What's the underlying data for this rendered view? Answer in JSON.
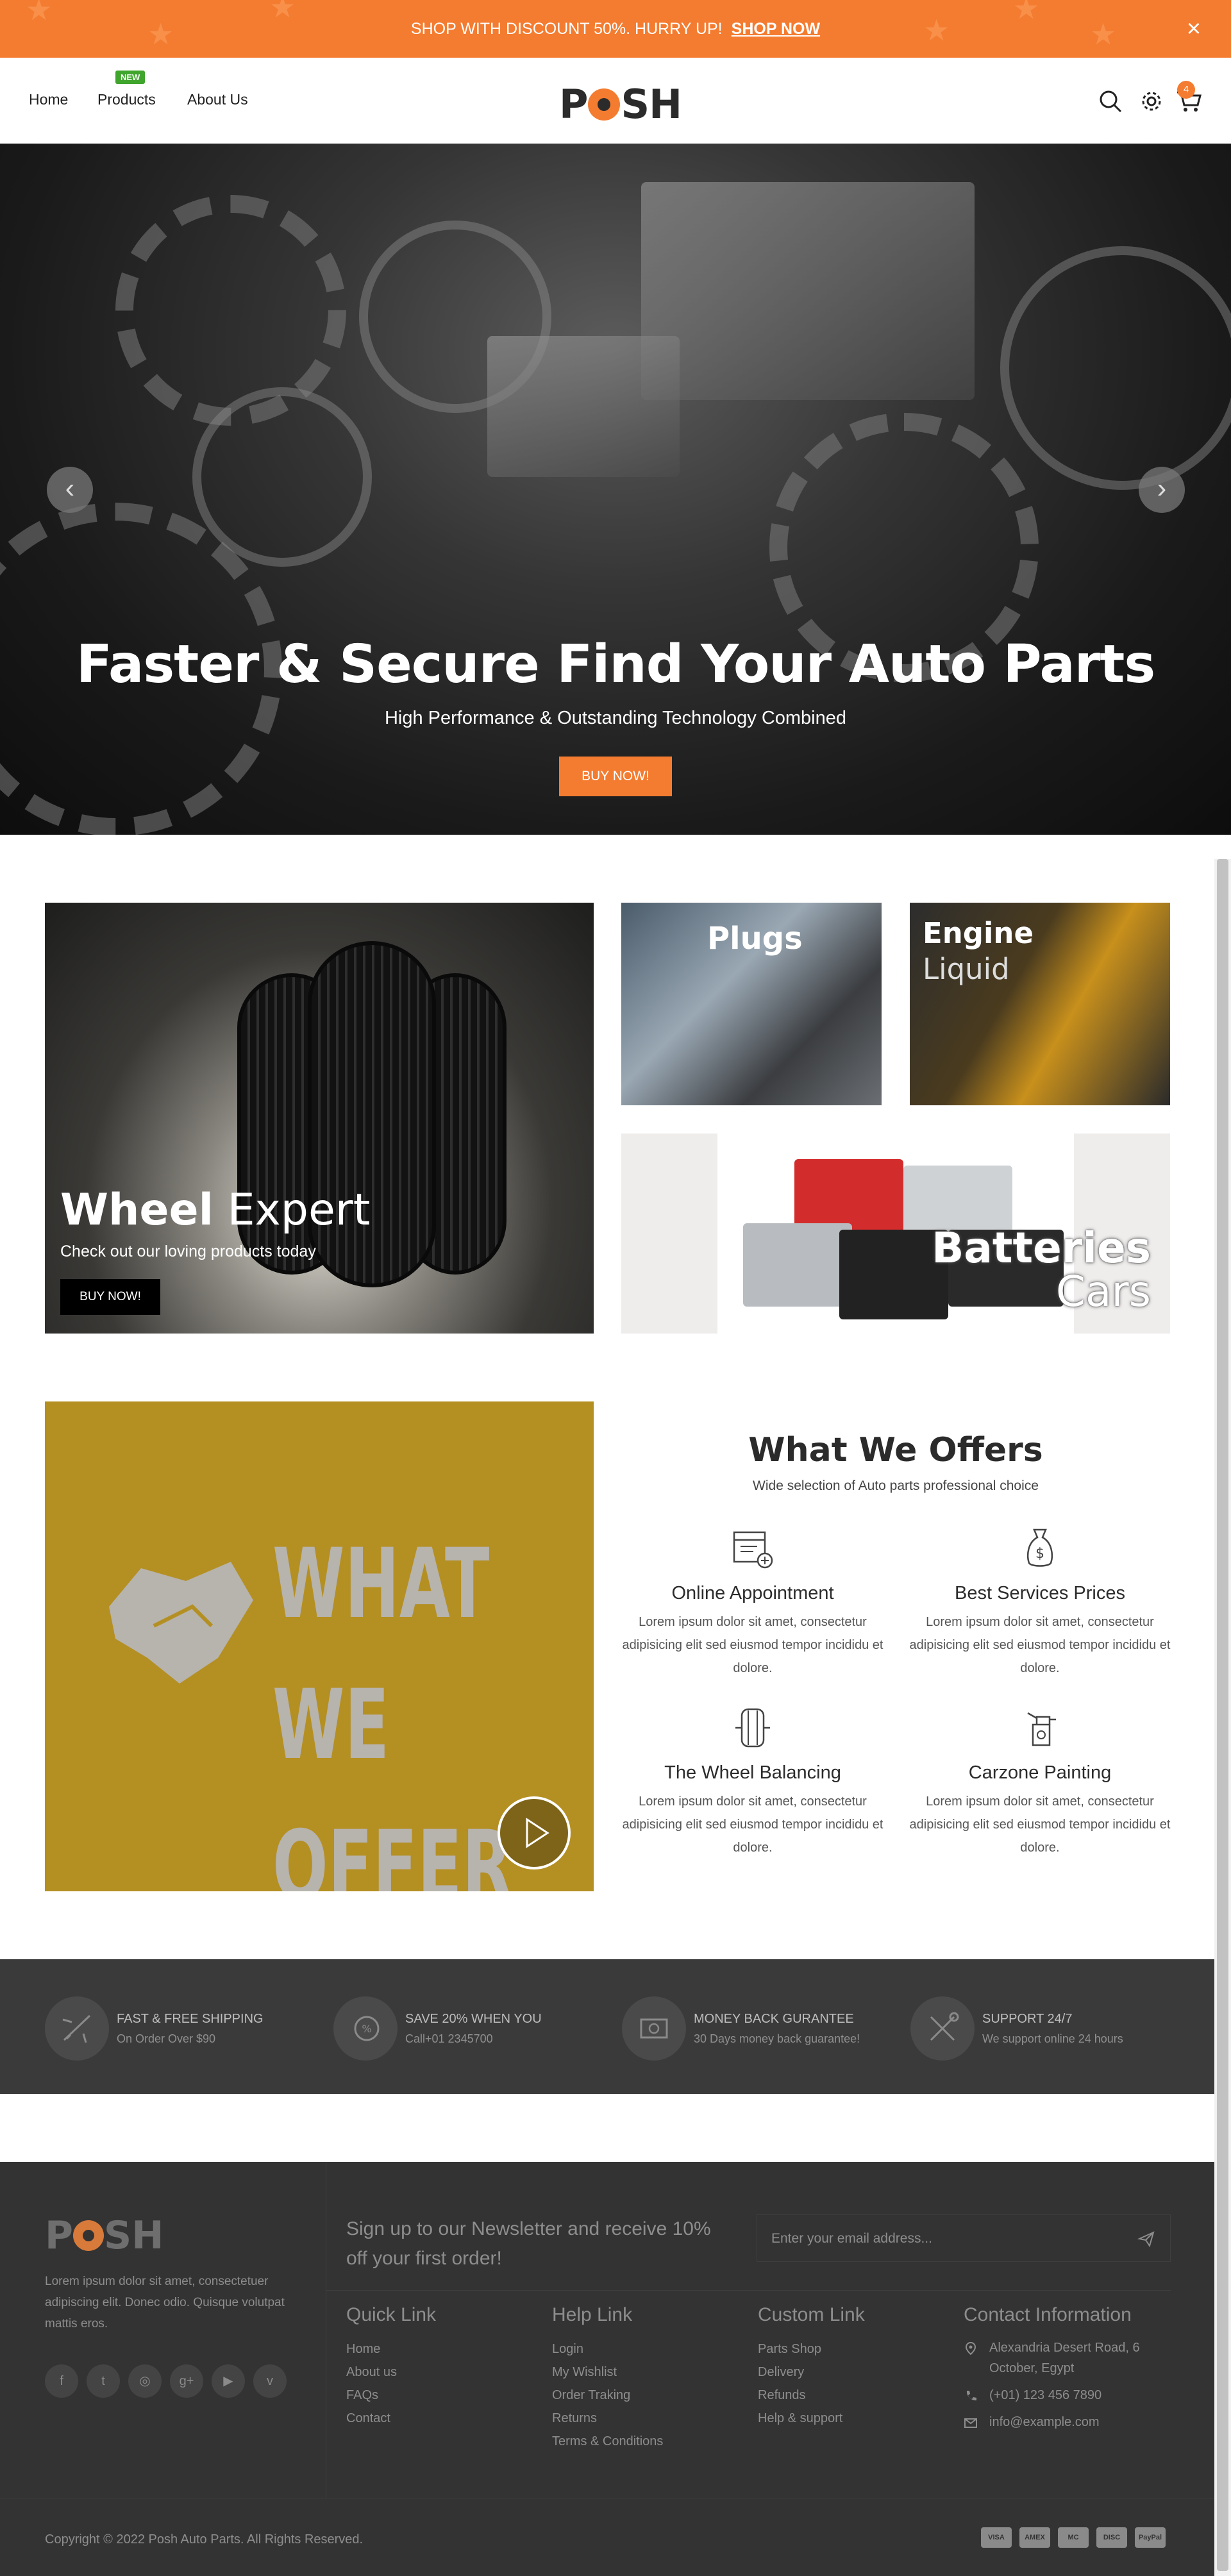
{
  "topbar": {
    "message": "SHOP WITH DISCOUNT 50%. HURRY UP!",
    "cta": "SHOP NOW",
    "close": "×"
  },
  "header": {
    "nav": [
      {
        "label": "Home"
      },
      {
        "label": "Products",
        "badge": "NEW"
      },
      {
        "label": "About Us"
      }
    ],
    "logo_parts": [
      "P",
      "SH"
    ],
    "cart_count": "4",
    "icons": [
      "search-icon",
      "gear-icon",
      "cart-icon"
    ]
  },
  "hero": {
    "title": "Faster & Secure Find Your Auto Parts",
    "subtitle": "High Performance & Outstanding Technology Combined",
    "button": "BUY NOW!",
    "prev": "‹",
    "next": "›"
  },
  "banners": {
    "wheel": {
      "title_bold": "Wheel",
      "title_light": "Expert",
      "subtitle": "Check out our loving products today",
      "button": "BUY NOW!"
    },
    "plugs": {
      "title": "Plugs"
    },
    "engine": {
      "line1": "Engine",
      "line2": "Liquid"
    },
    "batteries": {
      "line1": "Batteries",
      "line2": "Cars"
    }
  },
  "offers": {
    "video_text": [
      "WHAT WE",
      "OFFER"
    ],
    "title": "What We Offers",
    "subtitle": "Wide selection of Auto parts professional choice",
    "items": [
      {
        "icon": "calendar-icon",
        "title": "Online Appointment",
        "desc": "Lorem ipsum dolor sit amet, consectetur adipisicing elit sed eiusmod tempor incididu et dolore."
      },
      {
        "icon": "money-bag-icon",
        "title": "Best Services Prices",
        "desc": "Lorem ipsum dolor sit amet, consectetur adipisicing elit sed eiusmod tempor incididu et dolore."
      },
      {
        "icon": "tire-icon",
        "title": "The Wheel Balancing",
        "desc": "Lorem ipsum dolor sit amet, consectetur adipisicing elit sed eiusmod tempor incididu et dolore."
      },
      {
        "icon": "spray-gun-icon",
        "title": "Carzone Painting",
        "desc": "Lorem ipsum dolor sit amet, consectetur adipisicing elit sed eiusmod tempor incididu et dolore."
      }
    ]
  },
  "features": [
    {
      "icon": "plane-icon",
      "title": "FAST & FREE SHIPPING",
      "sub": "On Order Over $90"
    },
    {
      "icon": "discount-icon",
      "title": "SAVE 20% WHEN YOU",
      "sub": "Call+01 2345700"
    },
    {
      "icon": "money-icon",
      "title": "MONEY BACK GURANTEE",
      "sub": "30 Days money back guarantee!"
    },
    {
      "icon": "tools-icon",
      "title": "SUPPORT 24/7",
      "sub": "We support online 24 hours"
    }
  ],
  "footer": {
    "logo_parts": [
      "P",
      "SH"
    ],
    "description": "Lorem ipsum dolor sit amet, consectetuer adipiscing elit. Donec odio. Quisque volutpat mattis eros.",
    "social": [
      "facebook-icon",
      "twitter-icon",
      "instagram-icon",
      "google-plus-icon",
      "youtube-icon",
      "vine-icon"
    ],
    "social_glyphs": [
      "f",
      "t",
      "◎",
      "g+",
      "▶",
      "v"
    ],
    "newsletter": "Sign up to our Newsletter and receive 10% off your first order!",
    "email_placeholder": "Enter your email address...",
    "quick_link": {
      "title": "Quick Link",
      "links": [
        "Home",
        "About us",
        "FAQs",
        "Contact"
      ]
    },
    "help_link": {
      "title": "Help Link",
      "links": [
        "Login",
        "My Wishlist",
        "Order Traking",
        "Returns",
        "Terms & Conditions"
      ]
    },
    "custom_link": {
      "title": "Custom Link",
      "links": [
        "Parts Shop",
        "Delivery",
        "Refunds",
        "Help & support"
      ]
    },
    "contact": {
      "title": "Contact Information",
      "address": "Alexandria Desert Road, 6 October, Egypt",
      "phone": "(+01) 123 456 7890",
      "email": "info@example.com"
    },
    "copyright": "Copyright © 2022 Posh Auto Parts. All Rights Reserved.",
    "payments": [
      "VISA",
      "AMEX",
      "MC",
      "DISC",
      "PayPal"
    ]
  },
  "colors": {
    "accent": "#f47c30",
    "dark": "#333333",
    "features_bg": "#3a3a3a",
    "video_bg": "#b48f22",
    "badge_green": "#3fa52d"
  }
}
